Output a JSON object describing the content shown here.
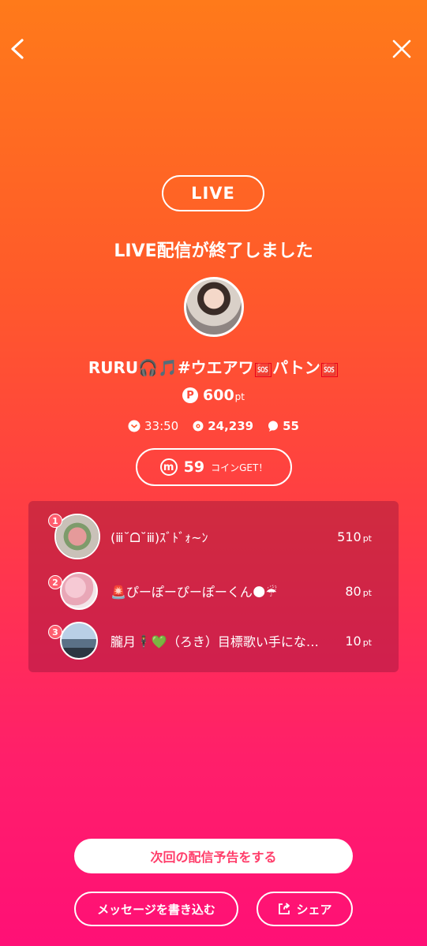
{
  "header": {
    "back_icon": "chevron-left-icon",
    "close_icon": "close-icon"
  },
  "badge": {
    "live_label": "LIVE"
  },
  "ended_message": "LIVE配信が終了しました",
  "streamer": {
    "title_prefix": "RURU🎧🎵#ウエアワ",
    "title_mid": "パトン",
    "sos_mark": "🆘"
  },
  "points": {
    "badge": "P",
    "value": "600",
    "unit": "pt"
  },
  "stats": {
    "duration": "33:50",
    "viewers": "24,239",
    "comments": "55"
  },
  "coins": {
    "icon": "m",
    "count": "59",
    "label": "コインGET！"
  },
  "ranking": [
    {
      "rank": "1",
      "name": "(ⅲ˘ᗝ˘ⅲ)ｽﾞﾄﾞｫ~ﾝ",
      "points": "510",
      "unit": "pt"
    },
    {
      "rank": "2",
      "name": "🚨ぴーぽーぴーぽーくん🌑☔",
      "points": "80",
      "unit": "pt"
    },
    {
      "rank": "3",
      "name": "朧月🕴💚（ろき）目標歌い手にな…",
      "points": "10",
      "unit": "pt"
    }
  ],
  "buttons": {
    "reserve": "次回の配信予告をする",
    "message": "メッセージを書き込む",
    "share": "シェア"
  },
  "colors": {
    "accent": "#ff3d6a",
    "gradient_top": "#ff7a1a",
    "gradient_bottom": "#ff1076"
  }
}
